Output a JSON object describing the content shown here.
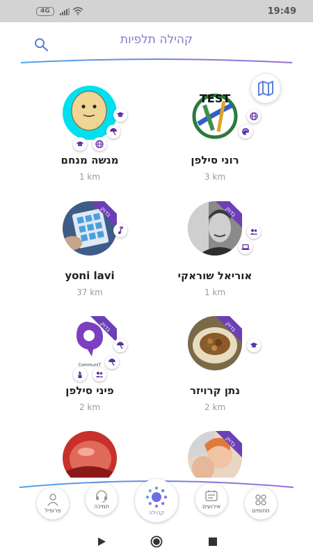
{
  "status_bar": {
    "network": "4G",
    "time": "19:49"
  },
  "header": {
    "title": "קהילה תלפיות"
  },
  "members": [
    {
      "name": "רוני סילפן",
      "distance": "3 km",
      "checked": false,
      "checked_label": ""
    },
    {
      "name": "מנשה מנחם",
      "distance": "1 km",
      "checked": false,
      "checked_label": ""
    },
    {
      "name": "אוריאל שוראקי",
      "distance": "1 km",
      "checked": true,
      "checked_label": "בדוק"
    },
    {
      "name": "yoni lavi",
      "distance": "37 km",
      "checked": true,
      "checked_label": "בדוק"
    },
    {
      "name": "נתן קרויזר",
      "distance": "2 km",
      "checked": true,
      "checked_label": "בדוק"
    },
    {
      "name": "פיני סילפן",
      "distance": "2 km",
      "checked": true,
      "checked_label": "בדוק"
    },
    {
      "name": "",
      "distance": "",
      "checked": true,
      "checked_label": "בדוק"
    },
    {
      "name": "",
      "distance": "",
      "checked": false,
      "checked_label": ""
    }
  ],
  "avatar_text": {
    "test": "TEST",
    "communit": "CommuniT"
  },
  "bottom_nav": [
    {
      "label": "תחומים",
      "icon": "grid-icon"
    },
    {
      "label": "אירועים",
      "icon": "calendar-icon"
    },
    {
      "label": "קהילה",
      "icon": "community-icon",
      "active": true
    },
    {
      "label": "תמיכה",
      "icon": "headset-icon"
    },
    {
      "label": "פרופיל",
      "icon": "person-icon"
    }
  ],
  "colors": {
    "accent": "#8c74c8",
    "purple": "#6b3fb6",
    "blue": "#5b7fe0"
  }
}
